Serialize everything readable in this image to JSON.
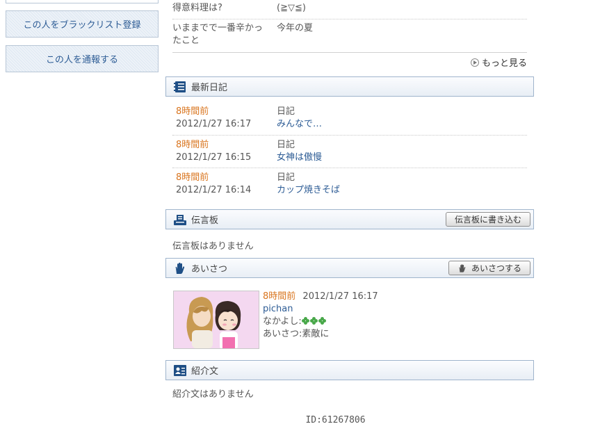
{
  "sidebar": {
    "blacklist_button": "この人をブラックリスト登録",
    "report_button": "この人を通報する"
  },
  "profile": {
    "rows": [
      {
        "label": "得意料理は?",
        "value": "(≧▽≦)"
      },
      {
        "label": "いままでで一番辛かったこと",
        "label_line1": "いままでで一番辛かっ",
        "label_line2": "たこと",
        "value": "今年の夏"
      }
    ],
    "more_link": "もっと見る"
  },
  "diary": {
    "title": "最新日記",
    "entries": [
      {
        "ago": "8時間前",
        "date": "2012/1/27 16:17",
        "category": "日記",
        "title": "みんなで…"
      },
      {
        "ago": "8時間前",
        "date": "2012/1/27 16:15",
        "category": "日記",
        "title": "女神は傲慢"
      },
      {
        "ago": "8時間前",
        "date": "2012/1/27 16:14",
        "category": "日記",
        "title": "カップ焼きそば"
      }
    ]
  },
  "board": {
    "title": "伝言板",
    "button": "伝言板に書き込む",
    "empty": "伝言板はありません"
  },
  "greeting": {
    "title": "あいさつ",
    "button": "あいさつする",
    "ago": "8時間前",
    "date": "2012/1/27 16:17",
    "user": "pichan",
    "friendship_label": "なかよし:",
    "friendship_level": 3,
    "greet_label": "あいさつ:素敵に"
  },
  "intro": {
    "title": "紹介文",
    "empty": "紹介文はありません"
  },
  "footer": {
    "id": "ID:61267806"
  },
  "colors": {
    "accent_orange": "#d9751f",
    "link_blue": "#2d5c95",
    "icon_navy": "#1f4f86",
    "clover_green": "#49a84a"
  }
}
